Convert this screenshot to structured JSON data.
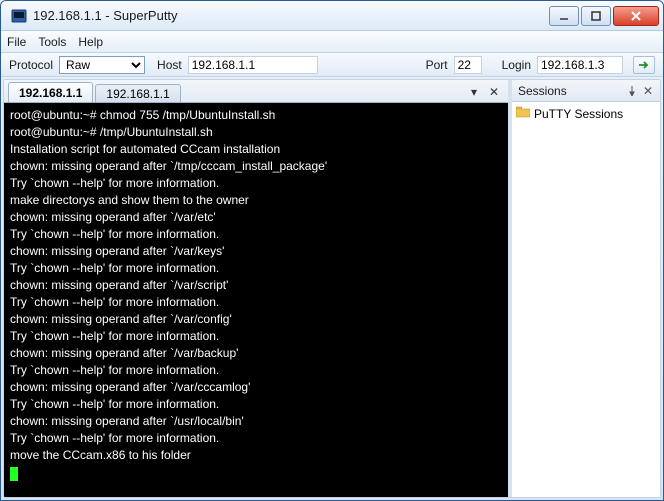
{
  "window": {
    "title": "192.168.1.1 - SuperPutty"
  },
  "menu": {
    "file": "File",
    "tools": "Tools",
    "help": "Help"
  },
  "connbar": {
    "protocol_label": "Protocol",
    "protocol_value": "Raw",
    "host_label": "Host",
    "host_value": "192.168.1.1",
    "port_label": "Port",
    "port_value": "22",
    "login_label": "Login",
    "login_value": "192.168.1.3"
  },
  "tabs": [
    {
      "label": "192.168.1.1"
    },
    {
      "label": "192.168.1.1"
    }
  ],
  "terminal": {
    "lines": [
      "root@ubuntu:~# chmod 755 /tmp/UbuntuInstall.sh",
      "root@ubuntu:~# /tmp/UbuntuInstall.sh",
      "Installation script for automated CCcam installation",
      "chown: missing operand after `/tmp/cccam_install_package'",
      "Try `chown --help' for more information.",
      "make directorys and show them to the owner",
      "chown: missing operand after `/var/etc'",
      "Try `chown --help' for more information.",
      "chown: missing operand after `/var/keys'",
      "Try `chown --help' for more information.",
      "chown: missing operand after `/var/script'",
      "Try `chown --help' for more information.",
      "chown: missing operand after `/var/config'",
      "Try `chown --help' for more information.",
      "chown: missing operand after `/var/backup'",
      "Try `chown --help' for more information.",
      "chown: missing operand after `/var/cccamlog'",
      "Try `chown --help' for more information.",
      "chown: missing operand after `/usr/local/bin'",
      "Try `chown --help' for more information.",
      "move the CCcam.x86 to his folder"
    ]
  },
  "sessions": {
    "panel_title": "Sessions",
    "root_node": "PuTTY Sessions"
  }
}
